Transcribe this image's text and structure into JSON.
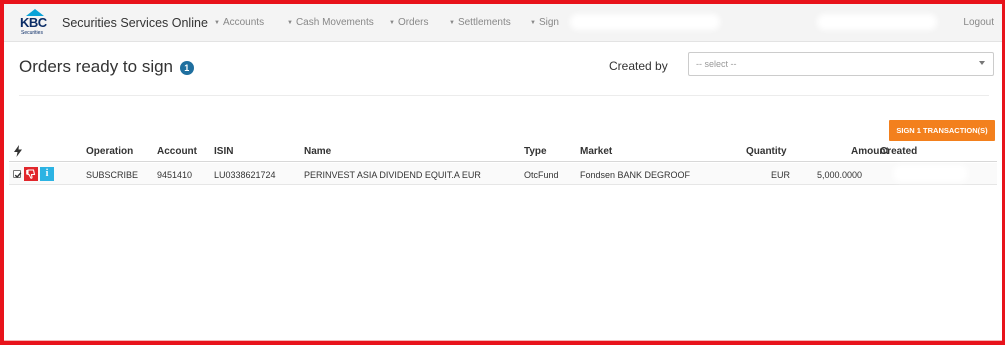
{
  "app": {
    "logo_text": "KBC",
    "logo_subtext": "Securities",
    "title": "Securities Services Online"
  },
  "nav": {
    "items": [
      {
        "label": "Accounts"
      },
      {
        "label": "Cash Movements"
      },
      {
        "label": "Orders"
      },
      {
        "label": "Settlements"
      },
      {
        "label": "Sign"
      }
    ],
    "logout_label": "Logout"
  },
  "page": {
    "title": "Orders ready to sign",
    "count_badge": "1"
  },
  "filter": {
    "created_by_label": "Created by",
    "created_by_value": "-- select --"
  },
  "actions": {
    "sign_label": "SIGN 1 TRANSACTION(S)"
  },
  "table": {
    "columns": [
      "Operation",
      "Account",
      "ISIN",
      "Name",
      "Type",
      "Market",
      "Quantity",
      "Amount",
      "Created"
    ],
    "rows": [
      {
        "operation": "SUBSCRIBE",
        "account": "9451410",
        "isin": "LU0338621724",
        "name": "PERINVEST ASIA DIVIDEND EQUIT.A EUR",
        "type": "OtcFund",
        "market": "Fondsen BANK DEGROOF",
        "quantity": "EUR",
        "amount": "5,000.0000",
        "created": "",
        "selected": true
      }
    ]
  },
  "icons": {
    "flash": "lightning-icon",
    "reject": "thumbs-down-icon",
    "info": "info-icon",
    "dropdown": "chevron-down-icon"
  },
  "colors": {
    "frame_red": "#e8131b",
    "accent_orange": "#f3801d",
    "reject_red": "#e1262b",
    "info_blue": "#2cb3e3",
    "badge_blue": "#1f6f9f"
  }
}
